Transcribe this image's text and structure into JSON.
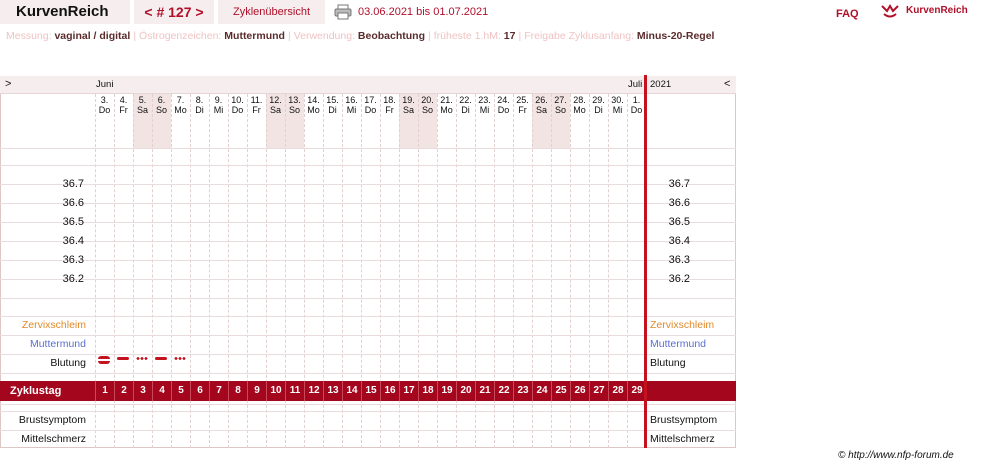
{
  "header": {
    "brand": "KurvenReich",
    "cycle_nav": "< # 127 >",
    "overview_label": "Zyklenübersicht",
    "date_range": "03.06.2021 bis 01.07.2021",
    "faq": "FAQ",
    "logo_text": "KurvenReich"
  },
  "settings": [
    {
      "key": "Messung:",
      "value": "vaginal / digital"
    },
    {
      "key": "Östrogenzeichen:",
      "value": "Muttermund"
    },
    {
      "key": "Verwendung:",
      "value": "Beobachtung"
    },
    {
      "key": "früheste 1.hM:",
      "value": "17"
    },
    {
      "key": "Freigabe Zyklusanfang:",
      "value": "Minus-20-Regel"
    }
  ],
  "chart": {
    "nav_prev": ">",
    "nav_next": "<",
    "months": [
      {
        "label": "Juni"
      },
      {
        "label": "Juli"
      }
    ],
    "year": "2021",
    "days": [
      {
        "num": "3.",
        "wd": "Do",
        "weekend": false
      },
      {
        "num": "4.",
        "wd": "Fr",
        "weekend": false
      },
      {
        "num": "5.",
        "wd": "Sa",
        "weekend": true
      },
      {
        "num": "6.",
        "wd": "So",
        "weekend": true
      },
      {
        "num": "7.",
        "wd": "Mo",
        "weekend": false
      },
      {
        "num": "8.",
        "wd": "Di",
        "weekend": false
      },
      {
        "num": "9.",
        "wd": "Mi",
        "weekend": false
      },
      {
        "num": "10.",
        "wd": "Do",
        "weekend": false
      },
      {
        "num": "11.",
        "wd": "Fr",
        "weekend": false
      },
      {
        "num": "12.",
        "wd": "Sa",
        "weekend": true
      },
      {
        "num": "13.",
        "wd": "So",
        "weekend": true
      },
      {
        "num": "14.",
        "wd": "Mo",
        "weekend": false
      },
      {
        "num": "15.",
        "wd": "Di",
        "weekend": false
      },
      {
        "num": "16.",
        "wd": "Mi",
        "weekend": false
      },
      {
        "num": "17.",
        "wd": "Do",
        "weekend": false
      },
      {
        "num": "18.",
        "wd": "Fr",
        "weekend": false
      },
      {
        "num": "19.",
        "wd": "Sa",
        "weekend": true
      },
      {
        "num": "20.",
        "wd": "So",
        "weekend": true
      },
      {
        "num": "21.",
        "wd": "Mo",
        "weekend": false
      },
      {
        "num": "22.",
        "wd": "Di",
        "weekend": false
      },
      {
        "num": "23.",
        "wd": "Mi",
        "weekend": false
      },
      {
        "num": "24.",
        "wd": "Do",
        "weekend": false
      },
      {
        "num": "25.",
        "wd": "Fr",
        "weekend": false
      },
      {
        "num": "26.",
        "wd": "Sa",
        "weekend": true
      },
      {
        "num": "27.",
        "wd": "So",
        "weekend": true
      },
      {
        "num": "28.",
        "wd": "Mo",
        "weekend": false
      },
      {
        "num": "29.",
        "wd": "Di",
        "weekend": false
      },
      {
        "num": "30.",
        "wd": "Mi",
        "weekend": false
      },
      {
        "num": "1.",
        "wd": "Do",
        "weekend": false
      }
    ],
    "temp_labels": [
      "36.7",
      "36.6",
      "36.5",
      "36.4",
      "36.3",
      "36.2"
    ],
    "rows": {
      "cervical": "Zervixschleim",
      "cervix": "Muttermund",
      "bleeding": "Blutung",
      "cycleday": "Zyklustag",
      "breast": "Brustsymptom",
      "midpain": "Mittelschmerz"
    },
    "bleeding_days": [
      {
        "day": 1,
        "style": "heavy"
      },
      {
        "day": 2,
        "style": "normal"
      },
      {
        "day": 3,
        "style": "light"
      },
      {
        "day": 4,
        "style": "normal"
      },
      {
        "day": 5,
        "style": "light"
      }
    ],
    "cycle_days": [
      "1",
      "2",
      "3",
      "4",
      "5",
      "6",
      "7",
      "8",
      "9",
      "10",
      "11",
      "12",
      "13",
      "14",
      "15",
      "16",
      "17",
      "18",
      "19",
      "20",
      "21",
      "22",
      "23",
      "24",
      "25",
      "26",
      "27",
      "28",
      "29"
    ]
  },
  "colors": {
    "accent": "#b0102a",
    "cycle_bar": "#a4061d",
    "cervical_label": "#e08a2a",
    "cervix_label": "#5b6fd0",
    "weekend_bg": "#f3e4e4"
  },
  "footer": {
    "copyright": "© http://www.nfp-forum.de"
  }
}
